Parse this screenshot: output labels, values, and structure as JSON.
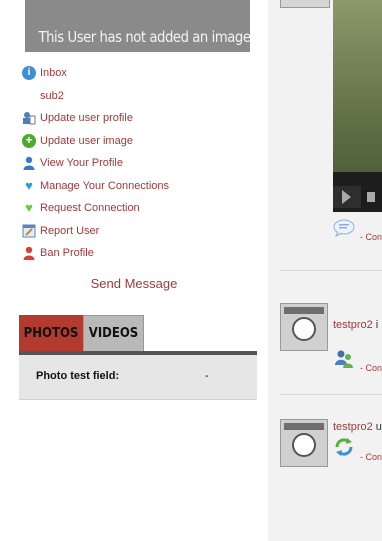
{
  "profile": {
    "no_image_text": "This User has not added an image yet."
  },
  "menu": [
    {
      "label": "Inbox",
      "icon": "info-icon"
    },
    {
      "label": "sub2",
      "icon": ""
    },
    {
      "label": "Update user profile",
      "icon": "update-profile-icon"
    },
    {
      "label": "Update user image",
      "icon": "add-icon"
    },
    {
      "label": "View Your Profile",
      "icon": "user-icon"
    },
    {
      "label": "Manage Your Connections",
      "icon": "heart-icon"
    },
    {
      "label": "Request Connection",
      "icon": "heart-plus-icon"
    },
    {
      "label": "Report User",
      "icon": "report-icon"
    },
    {
      "label": "Ban Profile",
      "icon": "ban-user-icon"
    }
  ],
  "send_message": "Send Message",
  "tabs": {
    "photos": "PHOTOS",
    "videos": "VIDEOS",
    "active": "PHOTOS"
  },
  "tab_panel": {
    "field_label": "Photo test field:",
    "field_value": "-"
  },
  "activity": {
    "comment_label_1": "- Con",
    "items": [
      {
        "user": "testpro2",
        "rest": " i",
        "comment_label": "- Con",
        "icon": "connection-users-icon"
      },
      {
        "user": "testpro2",
        "rest": " u",
        "comment_label": "- Con",
        "icon": "refresh-icon"
      }
    ]
  },
  "colors": {
    "link": "#a03a3a",
    "tab_active": "#b33a2e",
    "tab_inactive": "#b9b9b9"
  }
}
